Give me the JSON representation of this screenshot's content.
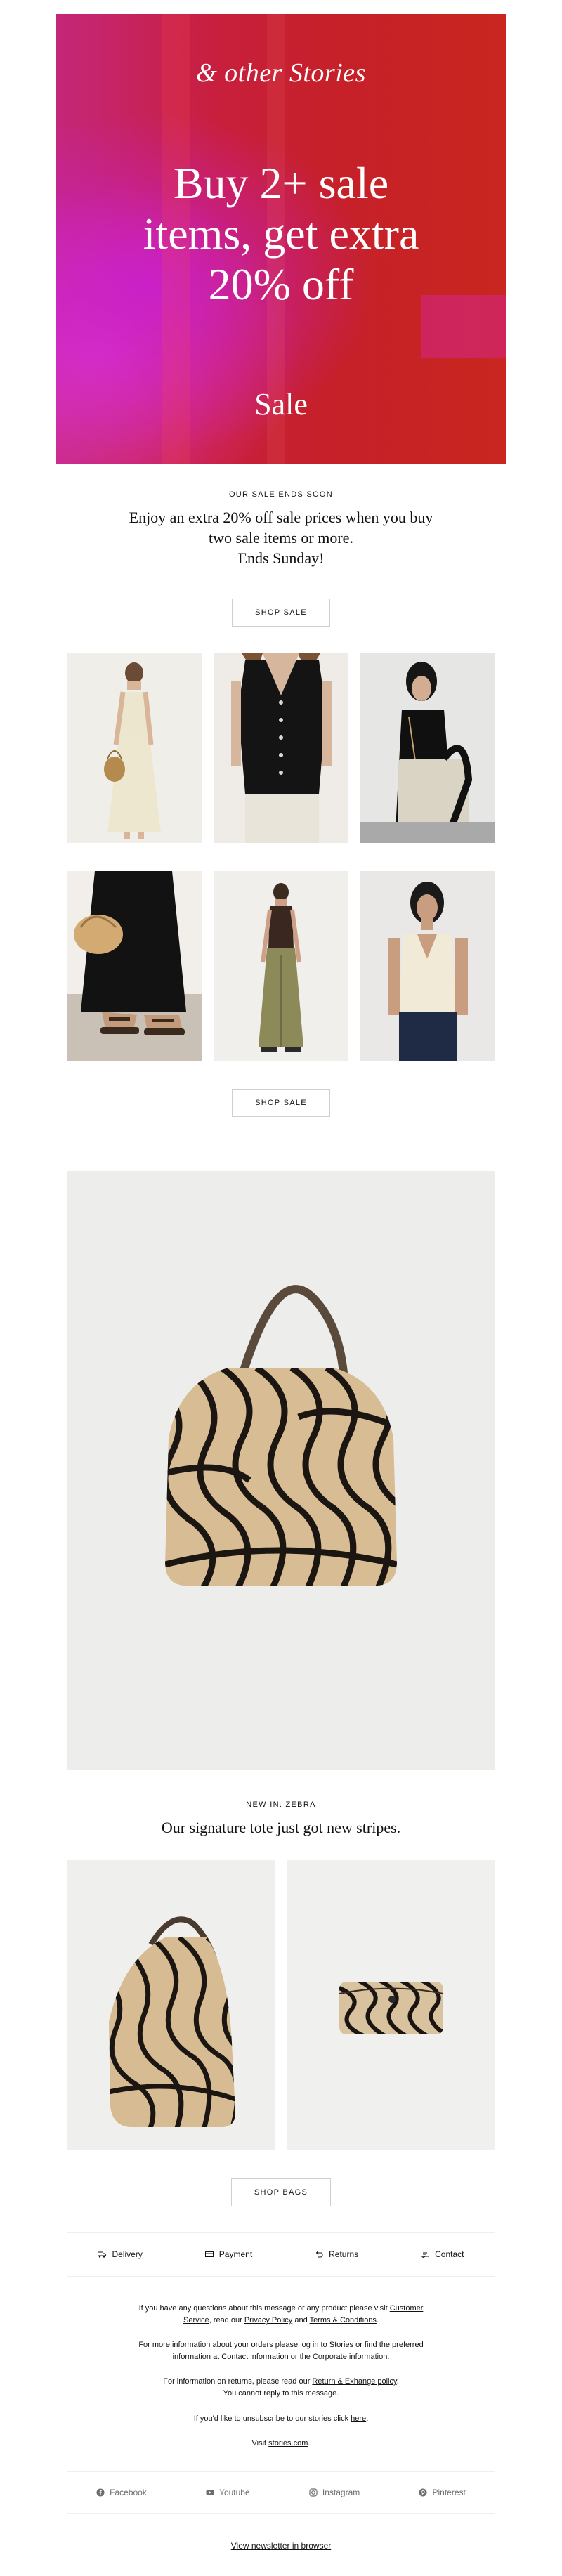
{
  "hero": {
    "logo": "& other Stories",
    "headline_line1": "Buy 2+ sale",
    "headline_line2": "items, get extra",
    "headline_line3": "20% off",
    "sale_label": "Sale"
  },
  "promo": {
    "eyebrow": "OUR SALE ENDS SOON",
    "body_line1": "Enjoy an extra 20% off sale prices when you buy",
    "body_line2": "two sale items or more.",
    "body_line3": "Ends Sunday!",
    "button": "SHOP SALE",
    "button2": "SHOP SALE"
  },
  "feature": {
    "eyebrow": "NEW IN: ZEBRA",
    "headline": "Our signature tote just got new stripes.",
    "button": "SHOP BAGS"
  },
  "footer_nav": [
    {
      "label": "Delivery",
      "icon": "truck-icon"
    },
    {
      "label": "Payment",
      "icon": "card-icon"
    },
    {
      "label": "Returns",
      "icon": "return-icon"
    },
    {
      "label": "Contact",
      "icon": "chat-icon"
    }
  ],
  "info": {
    "p1_a": "If you have any questions about this message or any product please visit ",
    "p1_link1": "Customer",
    "p1_link1b": "Service",
    "p1_b": ", read our ",
    "p1_link2": "Privacy Policy",
    "p1_c": " and ",
    "p1_link3": "Terms & Conditions",
    "p1_d": ".",
    "p2_a": "For more information about your orders please log in to Stories or find the preferred",
    "p2_b": "information at ",
    "p2_link1": "Contact information",
    "p2_c": " or the ",
    "p2_link2": "Corporate information",
    "p2_d": ".",
    "p3_a": "For information on returns, please read our ",
    "p3_link": "Return & Exhange policy",
    "p3_b": ".",
    "p3_line2": "You cannot reply to this message.",
    "p4_a": "If you'd like to unsubscribe to our stories click ",
    "p4_link": "here",
    "p4_b": ".",
    "p5_a": "Visit ",
    "p5_link": "stories.com",
    "p5_b": "."
  },
  "social": [
    {
      "label": "Facebook",
      "icon": "facebook-icon"
    },
    {
      "label": "Youtube",
      "icon": "youtube-icon"
    },
    {
      "label": "Instagram",
      "icon": "instagram-icon"
    },
    {
      "label": "Pinterest",
      "icon": "pinterest-icon"
    }
  ],
  "browser_link": "View newsletter in browser",
  "colors": {
    "hero_red": "#c6202a",
    "hero_magenta": "#c81fd2",
    "text": "#111111",
    "muted": "#6d6d6d"
  }
}
